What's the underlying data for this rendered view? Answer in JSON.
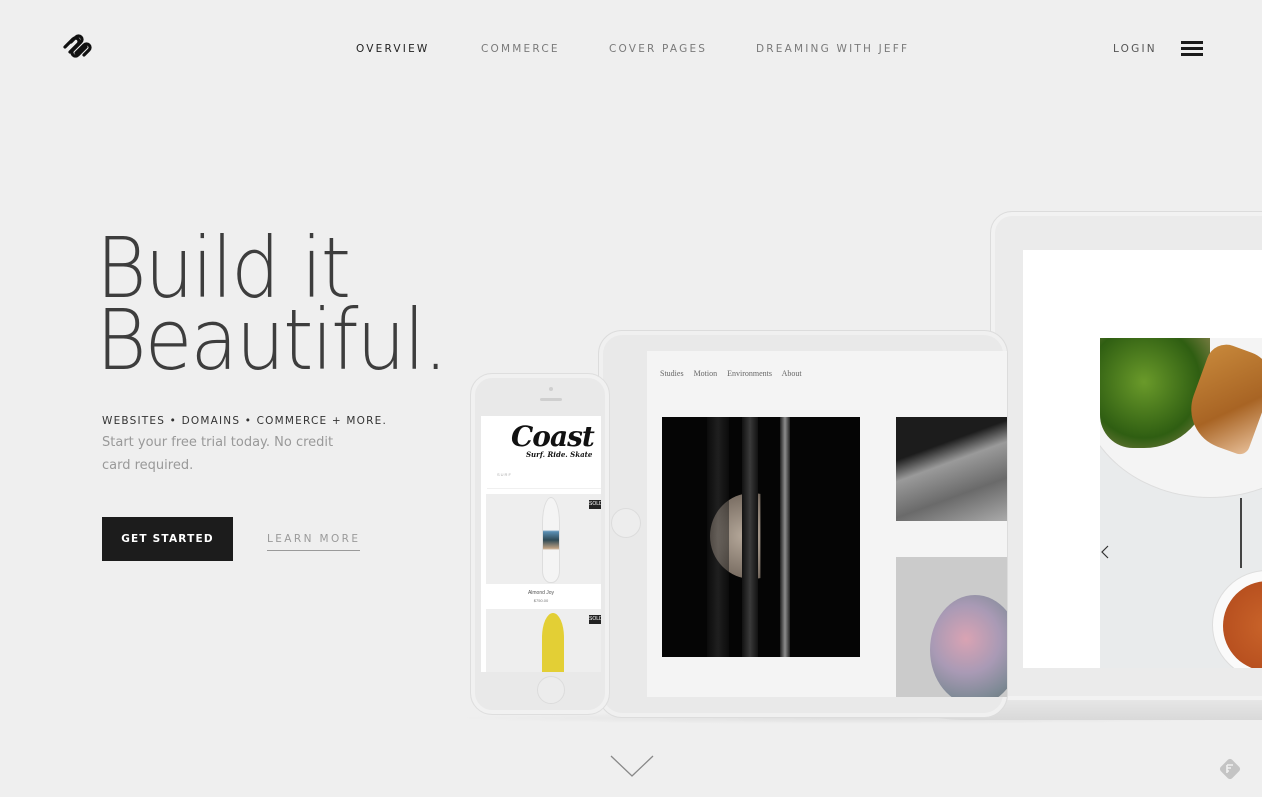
{
  "header": {
    "logo_icon": "squarespace-logo-icon",
    "nav": [
      {
        "label": "OVERVIEW",
        "active": true
      },
      {
        "label": "COMMERCE",
        "active": false
      },
      {
        "label": "COVER PAGES",
        "active": false
      },
      {
        "label": "DREAMING WITH JEFF",
        "active": false
      }
    ],
    "login_label": "LOGIN",
    "menu_icon": "hamburger-menu-icon"
  },
  "hero": {
    "title_line1": "Build it",
    "title_line2": "Beautiful.",
    "tagline": "WEBSITES • DOMAINS • COMMERCE + MORE.",
    "subtext": "Start your free trial today. No credit card required.",
    "primary_button": "GET STARTED",
    "secondary_link": "LEARN MORE"
  },
  "devices": {
    "phone": {
      "site_logo": "Coast",
      "site_tagline": "Surf. Ride. Skate",
      "site_nav": "SURF",
      "badge": "SOLD",
      "products": [
        {
          "name": "Almond Joy",
          "price": "$750.00"
        }
      ]
    },
    "tablet": {
      "nav": [
        "Studies",
        "Motion",
        "Environments",
        "About"
      ]
    },
    "laptop": {
      "slide_prev_icon": "chevron-left-icon"
    }
  },
  "footer": {
    "scroll_icon": "chevron-down-icon",
    "feedback_icon": "feedback-icon"
  }
}
